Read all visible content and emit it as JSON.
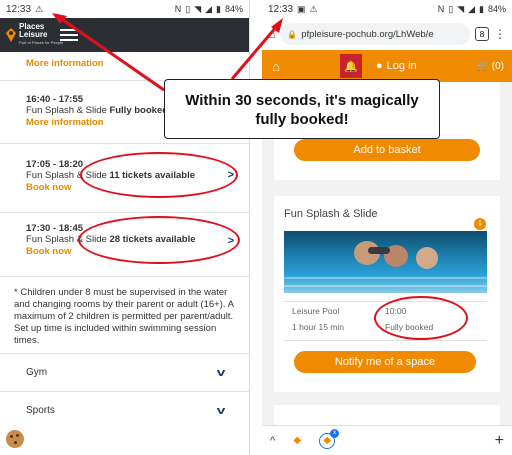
{
  "status_bar": {
    "left_time": "12:33",
    "right_time": "12:33",
    "battery": "84%"
  },
  "left": {
    "brand": {
      "name_line1": "Places",
      "name_line2": "Leisure",
      "tagline": "Part of Places for People"
    },
    "top_more": "More information",
    "sessions": [
      {
        "time": "16:40 - 17:55",
        "name": "Fun Splash & Slide",
        "status": "Fully booked",
        "action": "More information"
      },
      {
        "time": "17:05 - 18:20",
        "name": "Fun Splash & Slide",
        "status": "11 tickets available",
        "action": "Book now"
      },
      {
        "time": "17:30 - 18:45",
        "name": "Fun Splash & Slide",
        "status": "28 tickets available",
        "action": "Book now"
      }
    ],
    "note": "* Children under 8 must be supervised in the water and changing rooms by their parent or adult (16+). A maximum of 2 children is permitted per parent/adult. Set up time is included within swimming session times.",
    "accordion": [
      "Gym",
      "Sports"
    ]
  },
  "right": {
    "url": "pfpleisure-pochub.org/LhWeb/e",
    "tab_count": "8",
    "nav": {
      "login": "Log in",
      "basket_count": "(0)"
    },
    "add_basket": "Add to basket",
    "activity_title": "Fun Splash & Slide",
    "info_icon": "i",
    "location": "Leisure Pool",
    "start_time": "10:00",
    "duration": "1 hour 15 min",
    "availability": "Fully booked",
    "notify": "Notify me of a space"
  },
  "callout": {
    "line1": "Within 30 seconds, it's magically",
    "line2": "fully booked!"
  },
  "colors": {
    "accent": "#f08a00",
    "annotation": "#e0101a",
    "nav_dark": "#2b2f33",
    "bell_red": "#c8232c"
  }
}
